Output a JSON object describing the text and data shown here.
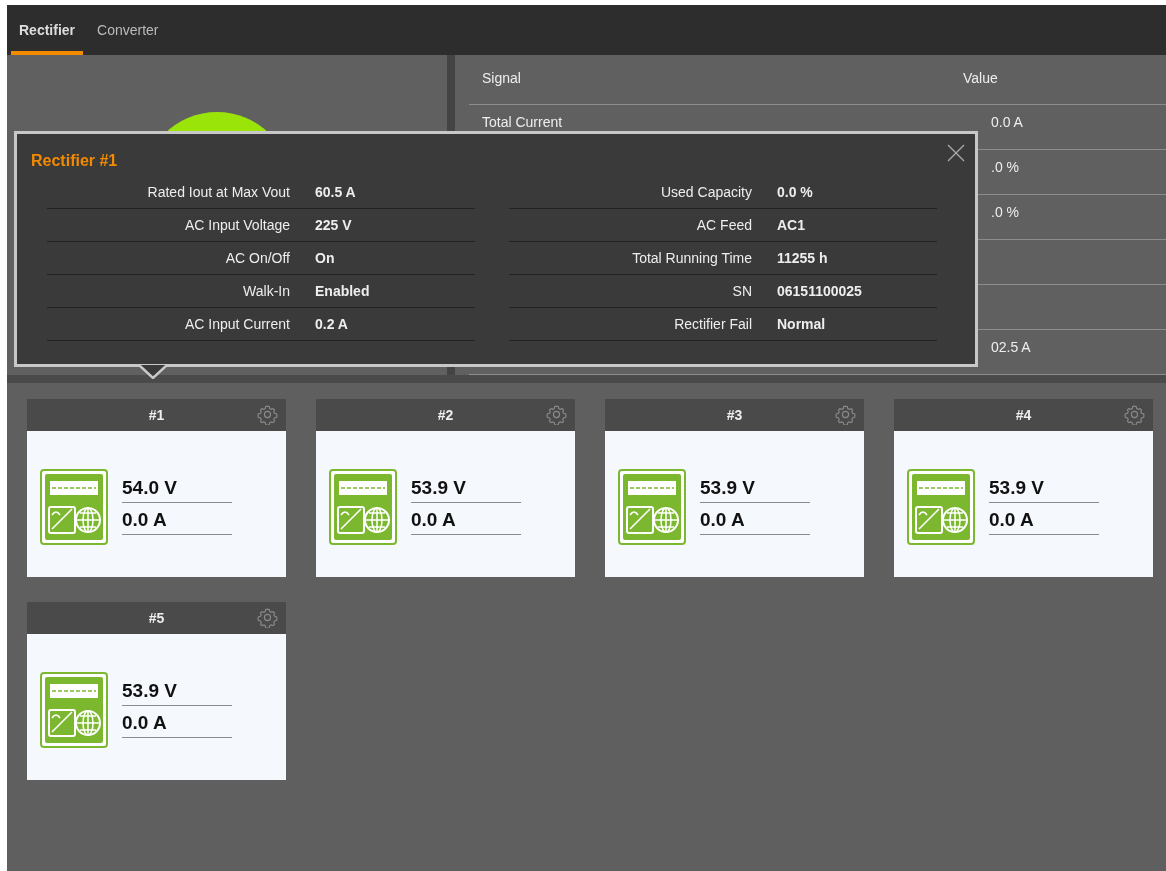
{
  "tabs": [
    {
      "label": "Rectifier",
      "selected": true
    },
    {
      "label": "Converter",
      "selected": false
    }
  ],
  "signal_table": {
    "columns": [
      "Signal",
      "Value"
    ],
    "rows": [
      {
        "signal": "Total Current",
        "value": "0.0 A"
      },
      {
        "value": ".0 %"
      },
      {
        "value": ".0 %"
      },
      {},
      {},
      {
        "value": "02.5 A"
      }
    ]
  },
  "popup": {
    "title": "Rectifier #1",
    "columns": [
      [
        {
          "label": "Rated Iout at Max Vout",
          "value": "60.5 A"
        },
        {
          "label": "AC Input Voltage",
          "value": "225 V"
        },
        {
          "label": "AC On/Off",
          "value": "On"
        },
        {
          "label": "Walk-In",
          "value": "Enabled"
        },
        {
          "label": "AC Input Current",
          "value": "0.2 A"
        }
      ],
      [
        {
          "label": "Used Capacity",
          "value": "0.0 %"
        },
        {
          "label": "AC Feed",
          "value": "AC1"
        },
        {
          "label": "Total Running Time",
          "value": "11255 h"
        },
        {
          "label": "SN",
          "value": "06151100025"
        },
        {
          "label": "Rectifier Fail",
          "value": "Normal"
        }
      ]
    ]
  },
  "rectifiers": [
    {
      "title": "#1",
      "voltage": "54.0 V",
      "current": "0.0 A"
    },
    {
      "title": "#2",
      "voltage": "53.9 V",
      "current": "0.0 A"
    },
    {
      "title": "#3",
      "voltage": "53.9 V",
      "current": "0.0 A"
    },
    {
      "title": "#4",
      "voltage": "53.9 V",
      "current": "0.0 A"
    },
    {
      "title": "#5",
      "voltage": "53.9 V",
      "current": "0.0 A"
    }
  ]
}
